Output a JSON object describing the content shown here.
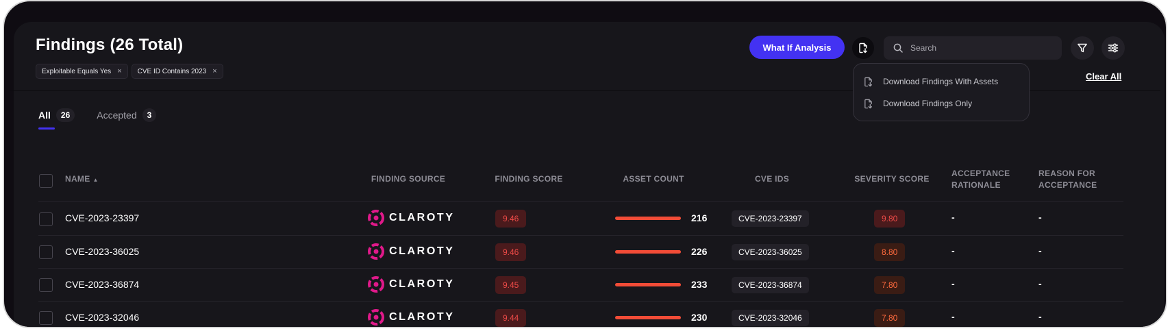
{
  "header": {
    "title": "Findings (26 Total)",
    "what_if_label": "What If Analysis",
    "search_placeholder": "Search",
    "clear_all": "Clear All"
  },
  "filters": [
    {
      "label": "Exploitable Equals Yes",
      "remove": "×"
    },
    {
      "label": "CVE ID Contains 2023",
      "remove": "×"
    }
  ],
  "download_menu": [
    {
      "label": "Download Findings With Assets",
      "icon": "download-file-icon"
    },
    {
      "label": "Download Findings Only",
      "icon": "download-file-icon"
    }
  ],
  "tabs": [
    {
      "label": "All",
      "count": "26",
      "active": true
    },
    {
      "label": "Accepted",
      "count": "3",
      "active": false
    }
  ],
  "columns": {
    "name": "NAME",
    "source": "FINDING SOURCE",
    "finding_score": "FINDING SCORE",
    "asset_count": "ASSET COUNT",
    "cve_ids": "CVE IDS",
    "severity_score": "SEVERITY SCORE",
    "acceptance_rationale_1": "ACCEPTANCE",
    "acceptance_rationale_2": "RATIONALE",
    "reason_1": "REASON FOR",
    "reason_2": "ACCEPTANCE"
  },
  "rows": [
    {
      "name": "CVE-2023-23397",
      "source": "CLAROTY",
      "finding_score": "9.46",
      "asset_count": "216",
      "cve_id": "CVE-2023-23397",
      "severity_score": "9.80",
      "severity_level": "red",
      "rationale": "-",
      "reason": "-"
    },
    {
      "name": "CVE-2023-36025",
      "source": "CLAROTY",
      "finding_score": "9.46",
      "asset_count": "226",
      "cve_id": "CVE-2023-36025",
      "severity_score": "8.80",
      "severity_level": "orange",
      "rationale": "-",
      "reason": "-"
    },
    {
      "name": "CVE-2023-36874",
      "source": "CLAROTY",
      "finding_score": "9.45",
      "asset_count": "233",
      "cve_id": "CVE-2023-36874",
      "severity_score": "7.80",
      "severity_level": "orange",
      "rationale": "-",
      "reason": "-"
    },
    {
      "name": "CVE-2023-32046",
      "source": "CLAROTY",
      "finding_score": "9.44",
      "asset_count": "230",
      "cve_id": "CVE-2023-32046",
      "severity_score": "7.80",
      "severity_level": "orange",
      "rationale": "-",
      "reason": "-"
    }
  ],
  "colors": {
    "accent": "#4332f2",
    "bar": "#f24c37",
    "brand_magenta": "#e0198a",
    "score_red": "#ef4b48",
    "score_orange": "#ff6a3d"
  }
}
